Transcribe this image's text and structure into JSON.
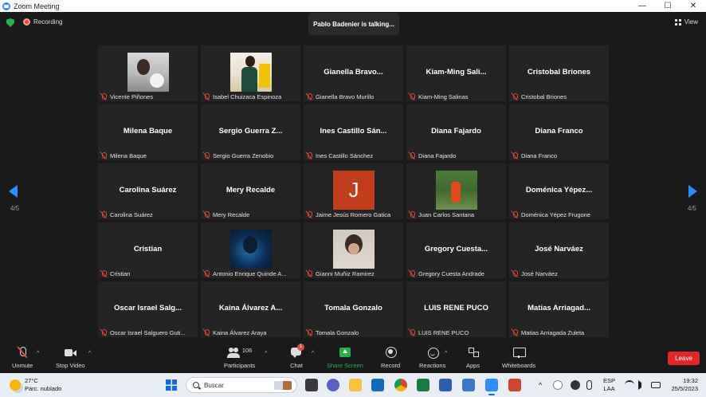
{
  "window": {
    "title": "Zoom Meeting",
    "controls": [
      "—",
      "☐",
      "✕"
    ]
  },
  "topbar": {
    "recording_label": "Recording",
    "talking_banner": "Pablo Badenier is talking...",
    "view_label": "View"
  },
  "pager": {
    "left_indicator": "4/5",
    "right_indicator": "4/5"
  },
  "participants": [
    {
      "name": "",
      "label": "Vicente Piñones",
      "photo": "ph1"
    },
    {
      "name": "",
      "label": "Isabel Chuizaca Espinoza",
      "photo": "ph2"
    },
    {
      "name": "Gianella  Bravo...",
      "label": "Gianella Bravo Murillo"
    },
    {
      "name": "Kiam-Ming  Sali...",
      "label": "Kiam-Ming Salinas"
    },
    {
      "name": "Cristobal Briones",
      "label": "Cristobal Briones"
    },
    {
      "name": "Milena Baque",
      "label": "Milena Baque"
    },
    {
      "name": "Sergio  Guerra  Z...",
      "label": "Sergio Guerra Zenobio"
    },
    {
      "name": "Ines  Castillo  Sán...",
      "label": "Ines Castillo Sánchez"
    },
    {
      "name": "Diana Fajardo",
      "label": "Diana Fajardo"
    },
    {
      "name": "Diana Franco",
      "label": "Diana Franco"
    },
    {
      "name": "Carolina Suárez",
      "label": "Carolina Suárez"
    },
    {
      "name": "Mery Recalde",
      "label": "Mery Recalde"
    },
    {
      "name": "",
      "label": "Jaime Jesús Romero Gatica",
      "photo": "ph3",
      "initial": "J"
    },
    {
      "name": "",
      "label": "Juan Carlos Santana",
      "photo": "ph4"
    },
    {
      "name": "Doménica  Yépez...",
      "label": "Doménica Yépez Frugone"
    },
    {
      "name": "Cristian",
      "label": "Cristian"
    },
    {
      "name": "",
      "label": "Antonio Enrique Quinde A...",
      "photo": "ph5"
    },
    {
      "name": "",
      "label": "Gianni Muñiz Ramirez",
      "photo": "ph6"
    },
    {
      "name": "Gregory  Cuesta...",
      "label": "Gregory Cuesta Andrade"
    },
    {
      "name": "José Narváez",
      "label": "José Narváez"
    },
    {
      "name": "Oscar  Israel  Salg...",
      "label": "Oscar Israel Salguero Guti..."
    },
    {
      "name": "Kaina  Álvarez  A...",
      "label": "Kaina Álvarez Araya"
    },
    {
      "name": "Tomala Gonzalo",
      "label": "Tomala Gonzalo"
    },
    {
      "name": "LUIS RENE PUCO",
      "label": "LUIS RENE PUCO"
    },
    {
      "name": "Matias  Arriagad...",
      "label": "Matias Arriagada Zuleta"
    }
  ],
  "toolbar": {
    "unmute": "Unmute",
    "stop_video": "Stop Video",
    "participants": "Participants",
    "participant_count": "106",
    "chat": "Chat",
    "chat_badge": "1",
    "share_screen": "Share Screen",
    "record": "Record",
    "reactions": "Reactions",
    "apps": "Apps",
    "whiteboards": "Whiteboards",
    "leave": "Leave"
  },
  "taskbar": {
    "temperature": "27°C",
    "weather": "Parc. nublado",
    "search_placeholder": "Buscar",
    "lang_top": "ESP",
    "lang_bottom": "LAA",
    "time": "19:32",
    "date": "25/5/2023"
  },
  "colors": {
    "accent": "#2d8cff",
    "leave": "#e02828",
    "share": "#23b14d",
    "muted": "#e0483a"
  }
}
